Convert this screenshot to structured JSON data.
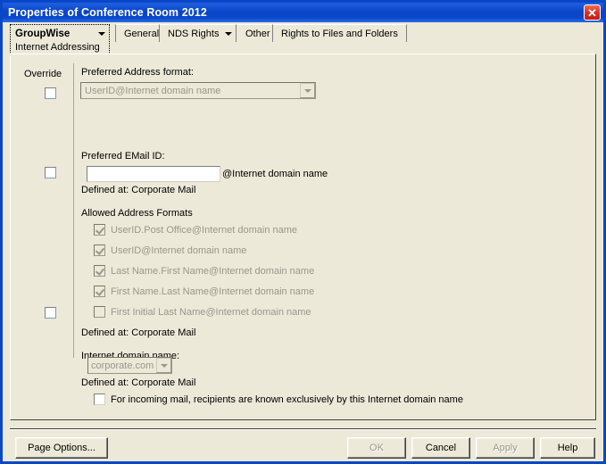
{
  "window": {
    "title": "Properties of Conference Room 2012",
    "close_icon": "close-icon",
    "close_glyph": "✕",
    "accent_titlebar_color": "#0A46C8",
    "close_button_color": "#D8342A",
    "dialog_background_color": "#ECE9D8"
  },
  "tabs": [
    {
      "label": "GroupWise",
      "sublabel": "Internet Addressing",
      "has_dropdown": true,
      "active": true
    },
    {
      "label": "General",
      "has_dropdown": false,
      "active": false
    },
    {
      "label": "NDS Rights",
      "has_dropdown": true,
      "active": false
    },
    {
      "label": "Other",
      "has_dropdown": false,
      "active": false
    },
    {
      "label": "Rights to Files and Folders",
      "has_dropdown": false,
      "active": false
    }
  ],
  "form": {
    "override_column_label": "Override",
    "preferred_address_format": {
      "label": "Preferred Address format:",
      "value": "UserID@Internet domain name",
      "enabled": false,
      "dropdown_icon": "chevron-down-icon"
    },
    "preferred_email_id": {
      "label": "Preferred EMail ID:",
      "value": "",
      "placeholder": "",
      "suffix": "@Internet domain name"
    },
    "defined_at_1": "Defined at:  Corporate Mail",
    "allowed_address_formats": {
      "label": "Allowed Address Formats",
      "items": [
        {
          "label": "UserID.Post Office@Internet domain name",
          "checked": true,
          "enabled": false
        },
        {
          "label": "UserID@Internet domain name",
          "checked": true,
          "enabled": false
        },
        {
          "label": "Last Name.First Name@Internet domain name",
          "checked": true,
          "enabled": false
        },
        {
          "label": "First Name.Last Name@Internet domain name",
          "checked": true,
          "enabled": false
        },
        {
          "label": "First Initial Last Name@Internet domain name",
          "checked": false,
          "enabled": false
        }
      ]
    },
    "defined_at_2": "Defined at:  Corporate Mail",
    "internet_domain_name": {
      "label": "Internet domain name:",
      "value": "corporate.com",
      "enabled": false,
      "dropdown_icon": "chevron-down-icon"
    },
    "defined_at_3": "Defined at:  Corporate Mail",
    "incoming_mail": {
      "label": "For incoming mail, recipients are known exclusively by this Internet domain name",
      "checked": false,
      "enabled": true
    }
  },
  "buttons": {
    "page_options": {
      "label": "Page Options...",
      "enabled": true
    },
    "ok": {
      "label": "OK",
      "enabled": false
    },
    "cancel": {
      "label": "Cancel",
      "enabled": true
    },
    "apply": {
      "label": "Apply",
      "enabled": false
    },
    "help": {
      "label": "Help",
      "enabled": true
    }
  }
}
